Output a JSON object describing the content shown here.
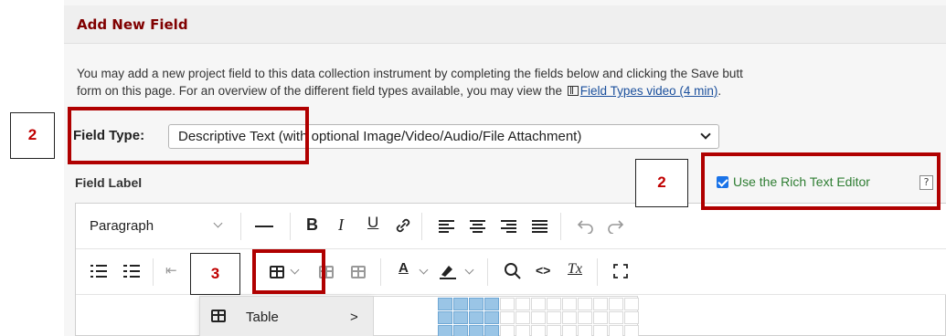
{
  "dialog": {
    "title": "Add New Field",
    "intro_line1": "You may add a new project field to this data collection instrument by completing the fields below and clicking the Save butt",
    "intro_line2_pre": "form on this page. For an overview of the different field types available, you may view the",
    "intro_link": "Field Types video (4 min)",
    "intro_line2_post": "."
  },
  "field_type": {
    "label": "Field Type:",
    "selected": "Descriptive Text (with optional Image/Video/Audio/File Attachment)"
  },
  "field_label": {
    "label": "Field Label"
  },
  "rich_text": {
    "label": "Use the Rich Text Editor",
    "checked": true,
    "help": "?"
  },
  "toolbar": {
    "paragraph": "Paragraph",
    "bold": "B",
    "italic": "I",
    "underline": "U",
    "text_color": "A",
    "clear_format": "Tx",
    "code": "<>"
  },
  "table_menu": {
    "item": "Table",
    "chevron": ">"
  },
  "annotations": {
    "box1": "2",
    "box2": "2",
    "box3": "3"
  },
  "colors": {
    "accent": "#800000",
    "annotation_red": "#b00000",
    "link": "#1a4f9c",
    "checkbox": "#1a73e8"
  }
}
